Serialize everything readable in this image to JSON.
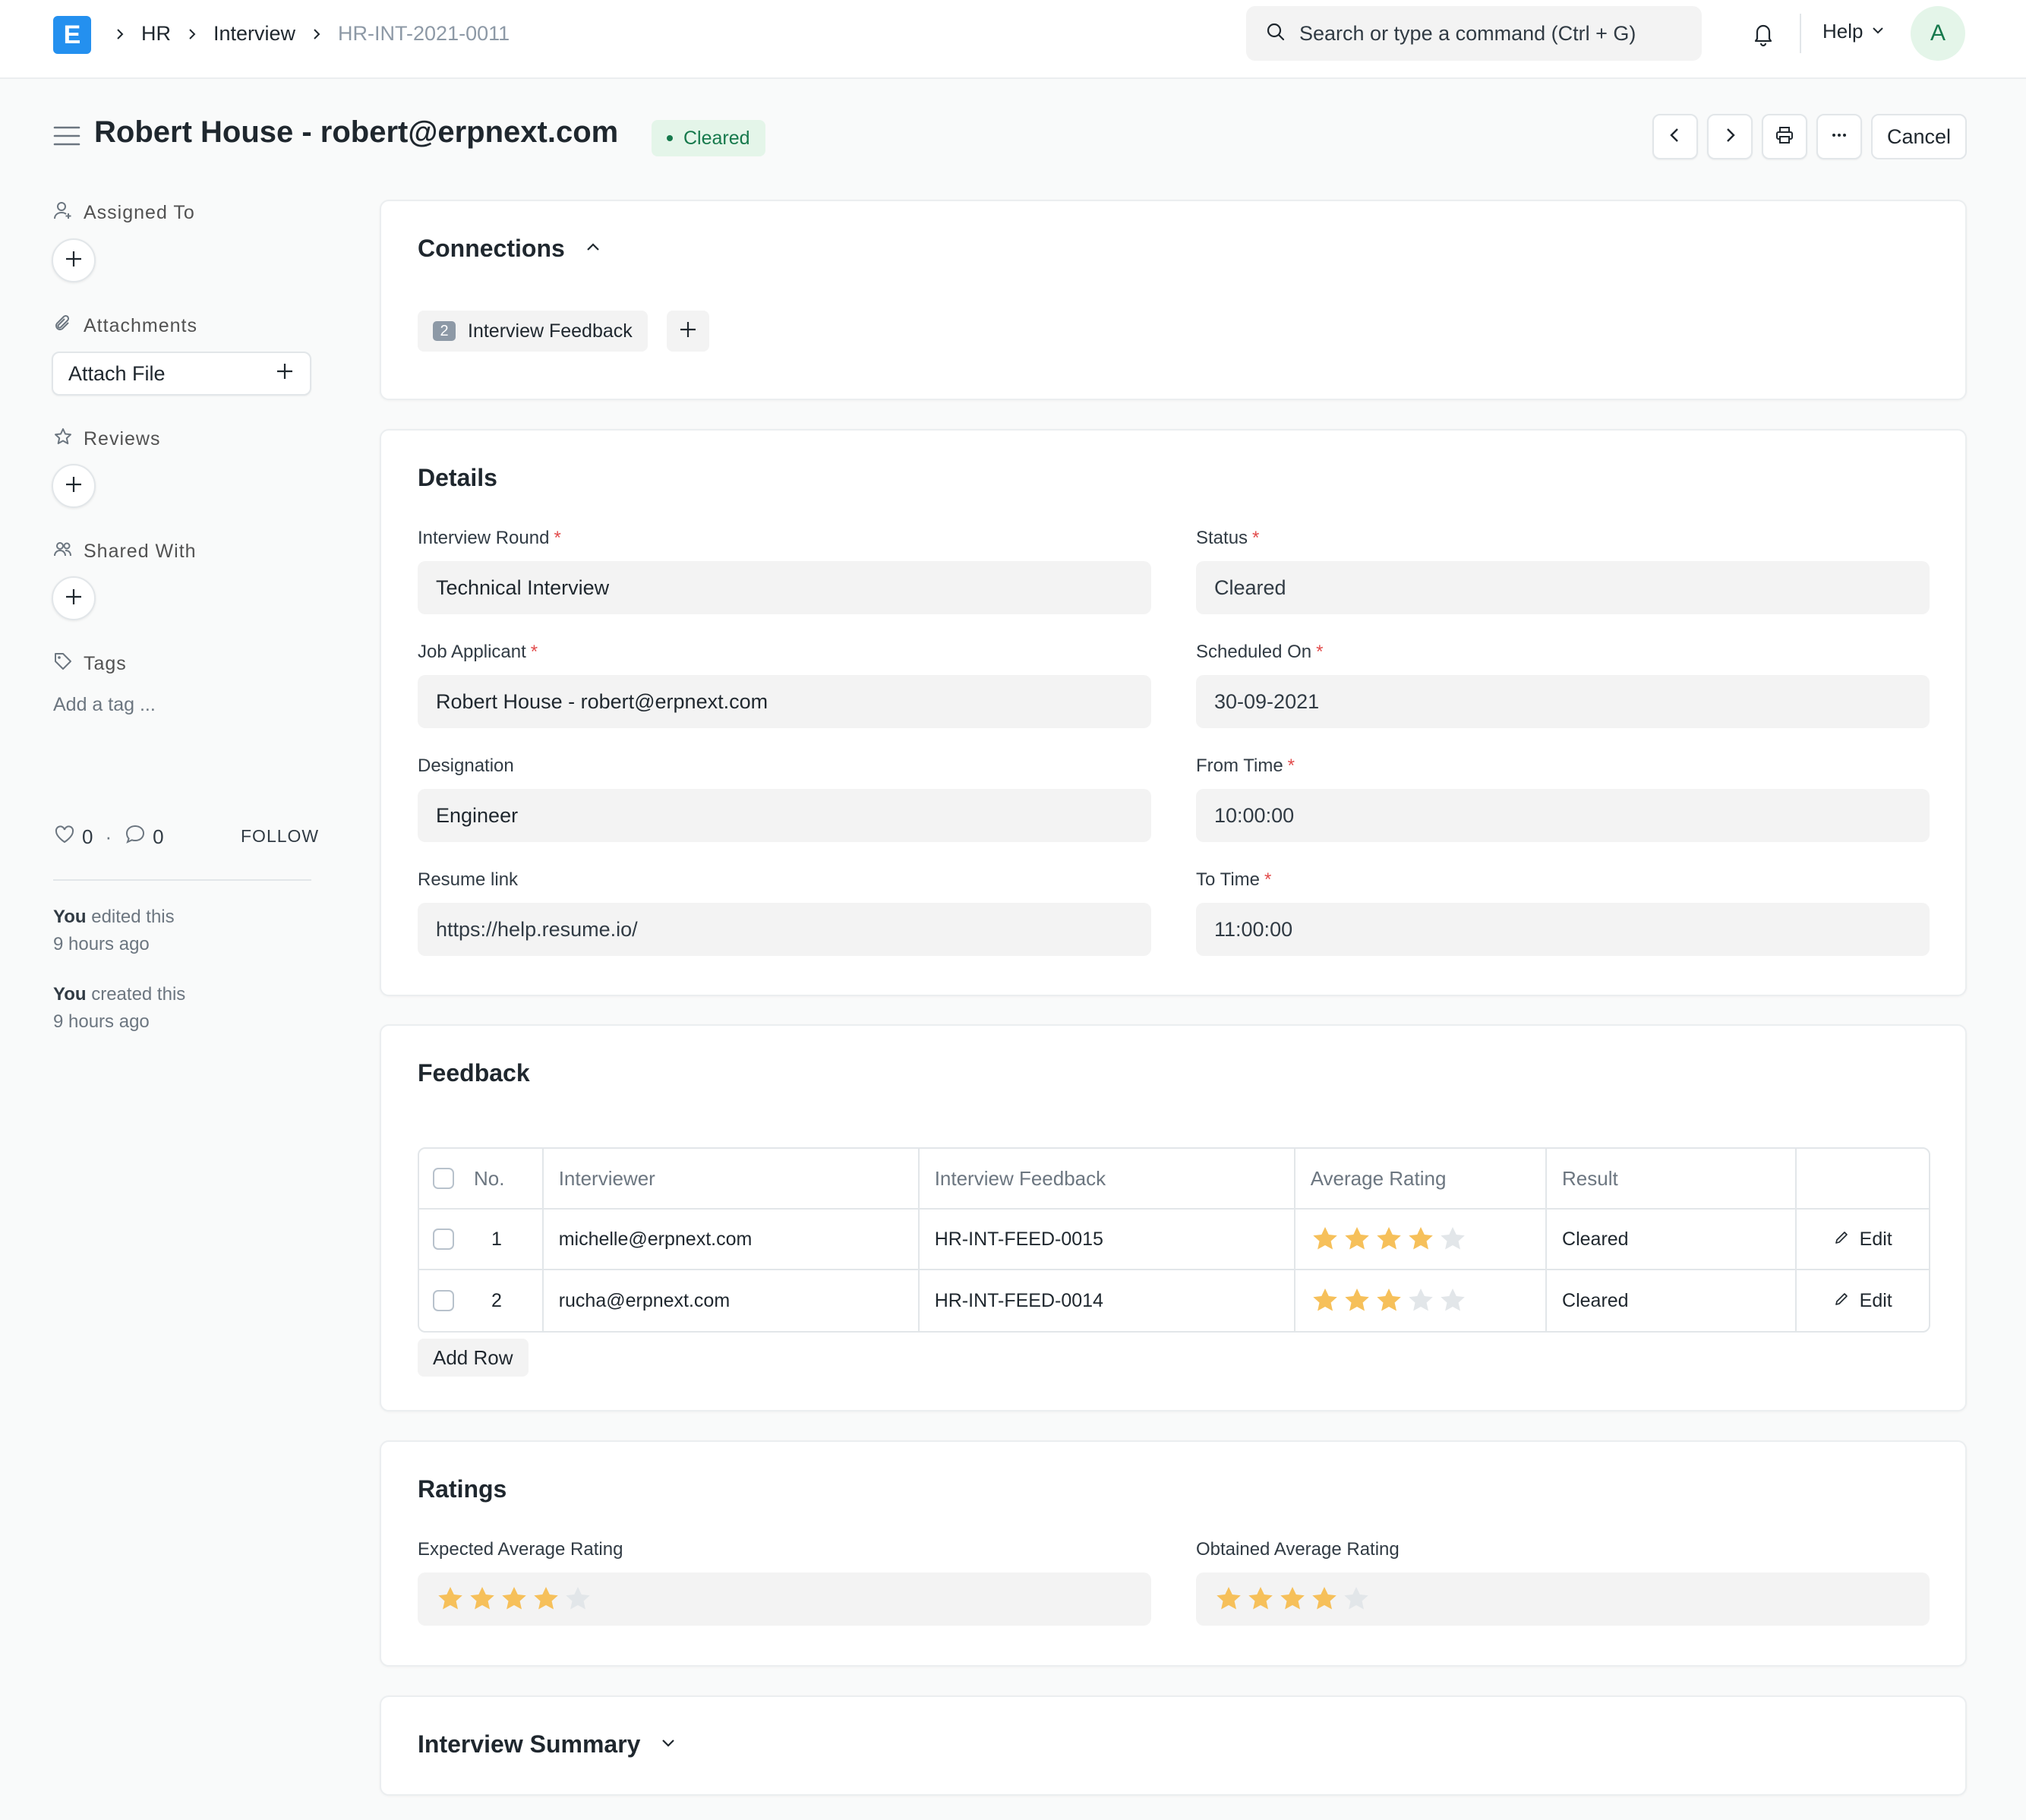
{
  "navbar": {
    "logo_letter": "E",
    "breadcrumbs": [
      "HR",
      "Interview",
      "HR-INT-2021-0011"
    ],
    "search_placeholder": "Search or type a command (Ctrl + G)",
    "help_label": "Help",
    "avatar_letter": "A"
  },
  "page": {
    "title": "Robert House - robert@erpnext.com",
    "status": "Cleared",
    "cancel_label": "Cancel"
  },
  "sidebar": {
    "assigned_to": "Assigned To",
    "attachments": "Attachments",
    "attach_file": "Attach File",
    "reviews": "Reviews",
    "shared_with": "Shared With",
    "tags": "Tags",
    "add_tag": "Add a tag ...",
    "likes": "0",
    "comments": "0",
    "dot": "·",
    "follow": "FOLLOW",
    "activity": [
      {
        "who": "You",
        "action": " edited this",
        "when": "9 hours ago"
      },
      {
        "who": "You",
        "action": " created this",
        "when": "9 hours ago"
      }
    ]
  },
  "connections": {
    "title": "Connections",
    "chip_count": "2",
    "chip_label": "Interview Feedback"
  },
  "details": {
    "title": "Details",
    "fields": {
      "interview_round": {
        "label": "Interview Round",
        "value": "Technical Interview",
        "required": "*"
      },
      "job_applicant": {
        "label": "Job Applicant",
        "value": "Robert House - robert@erpnext.com",
        "required": "*"
      },
      "designation": {
        "label": "Designation",
        "value": "Engineer"
      },
      "resume_link": {
        "label": "Resume link",
        "value": "https://help.resume.io/"
      },
      "status": {
        "label": "Status",
        "value": "Cleared",
        "required": "*"
      },
      "scheduled_on": {
        "label": "Scheduled On",
        "value": "30-09-2021",
        "required": "*"
      },
      "from_time": {
        "label": "From Time",
        "value": "10:00:00",
        "required": "*"
      },
      "to_time": {
        "label": "To Time",
        "value": "11:00:00",
        "required": "*"
      }
    }
  },
  "feedback": {
    "title": "Feedback",
    "columns": [
      "No.",
      "Interviewer",
      "Interview Feedback",
      "Average Rating",
      "Result"
    ],
    "rows": [
      {
        "no": "1",
        "interviewer": "michelle@erpnext.com",
        "feedback": "HR-INT-FEED-0015",
        "rating": 4,
        "result": "Cleared",
        "edit": "Edit"
      },
      {
        "no": "2",
        "interviewer": "rucha@erpnext.com",
        "feedback": "HR-INT-FEED-0014",
        "rating": 3,
        "result": "Cleared",
        "edit": "Edit"
      }
    ],
    "add_row": "Add Row"
  },
  "ratings": {
    "title": "Ratings",
    "expected_label": "Expected Average Rating",
    "expected_value": 4,
    "obtained_label": "Obtained Average Rating",
    "obtained_value": 4,
    "max": 5
  },
  "summary": {
    "title": "Interview Summary"
  },
  "colors": {
    "brand": "#2490ef",
    "success": "#16794c",
    "success_bg": "#e4f5e9",
    "star_filled": "#f6c05a",
    "star_empty": "#e2e6e9",
    "required": "#e24c4c"
  }
}
